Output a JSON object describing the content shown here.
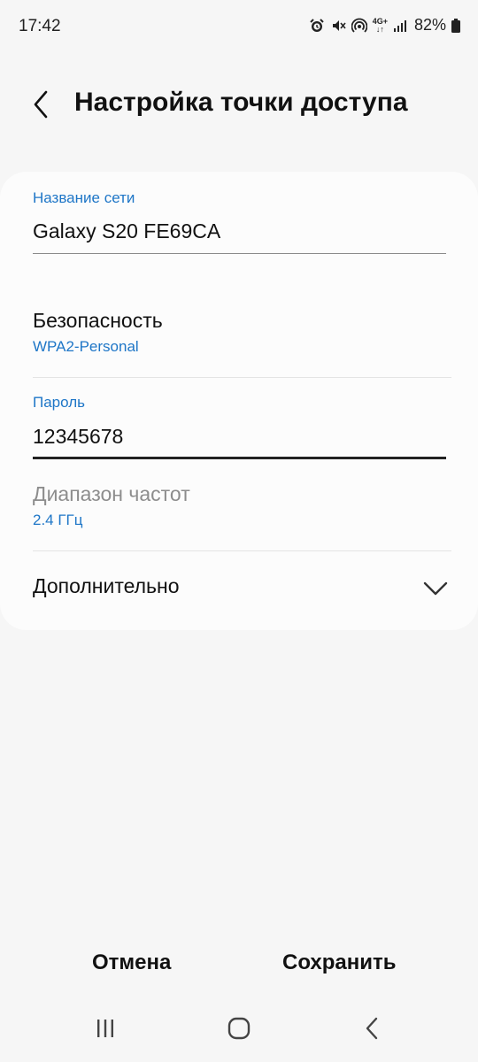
{
  "status_bar": {
    "time": "17:42",
    "network_type": "4G+",
    "battery_percent": "82%",
    "icons": [
      "alarm-icon",
      "mute-icon",
      "hotspot-icon",
      "network-4g-icon",
      "signal-icon",
      "battery-icon"
    ]
  },
  "header": {
    "title": "Настройка точки доступа",
    "back_icon": "back-arrow-icon"
  },
  "form": {
    "network_name": {
      "label": "Название сети",
      "value": "Galaxy S20 FE69CA"
    },
    "security": {
      "title": "Безопасность",
      "value": "WPA2-Personal"
    },
    "password": {
      "label": "Пароль",
      "value": "12345678"
    },
    "frequency": {
      "title": "Диапазон частот",
      "value": "2.4 ГГц",
      "enabled": false
    },
    "advanced": {
      "title": "Дополнительно",
      "icon": "chevron-down-icon"
    }
  },
  "actions": {
    "cancel_label": "Отмена",
    "save_label": "Сохранить"
  },
  "nav_bar": {
    "icons": [
      "recents-icon",
      "home-icon",
      "back-icon"
    ]
  },
  "colors": {
    "background": "#f6f6f6",
    "card": "#fcfcfc",
    "accent": "#1e76c7",
    "text": "#111111",
    "disabled_text": "#8d8d8d"
  }
}
